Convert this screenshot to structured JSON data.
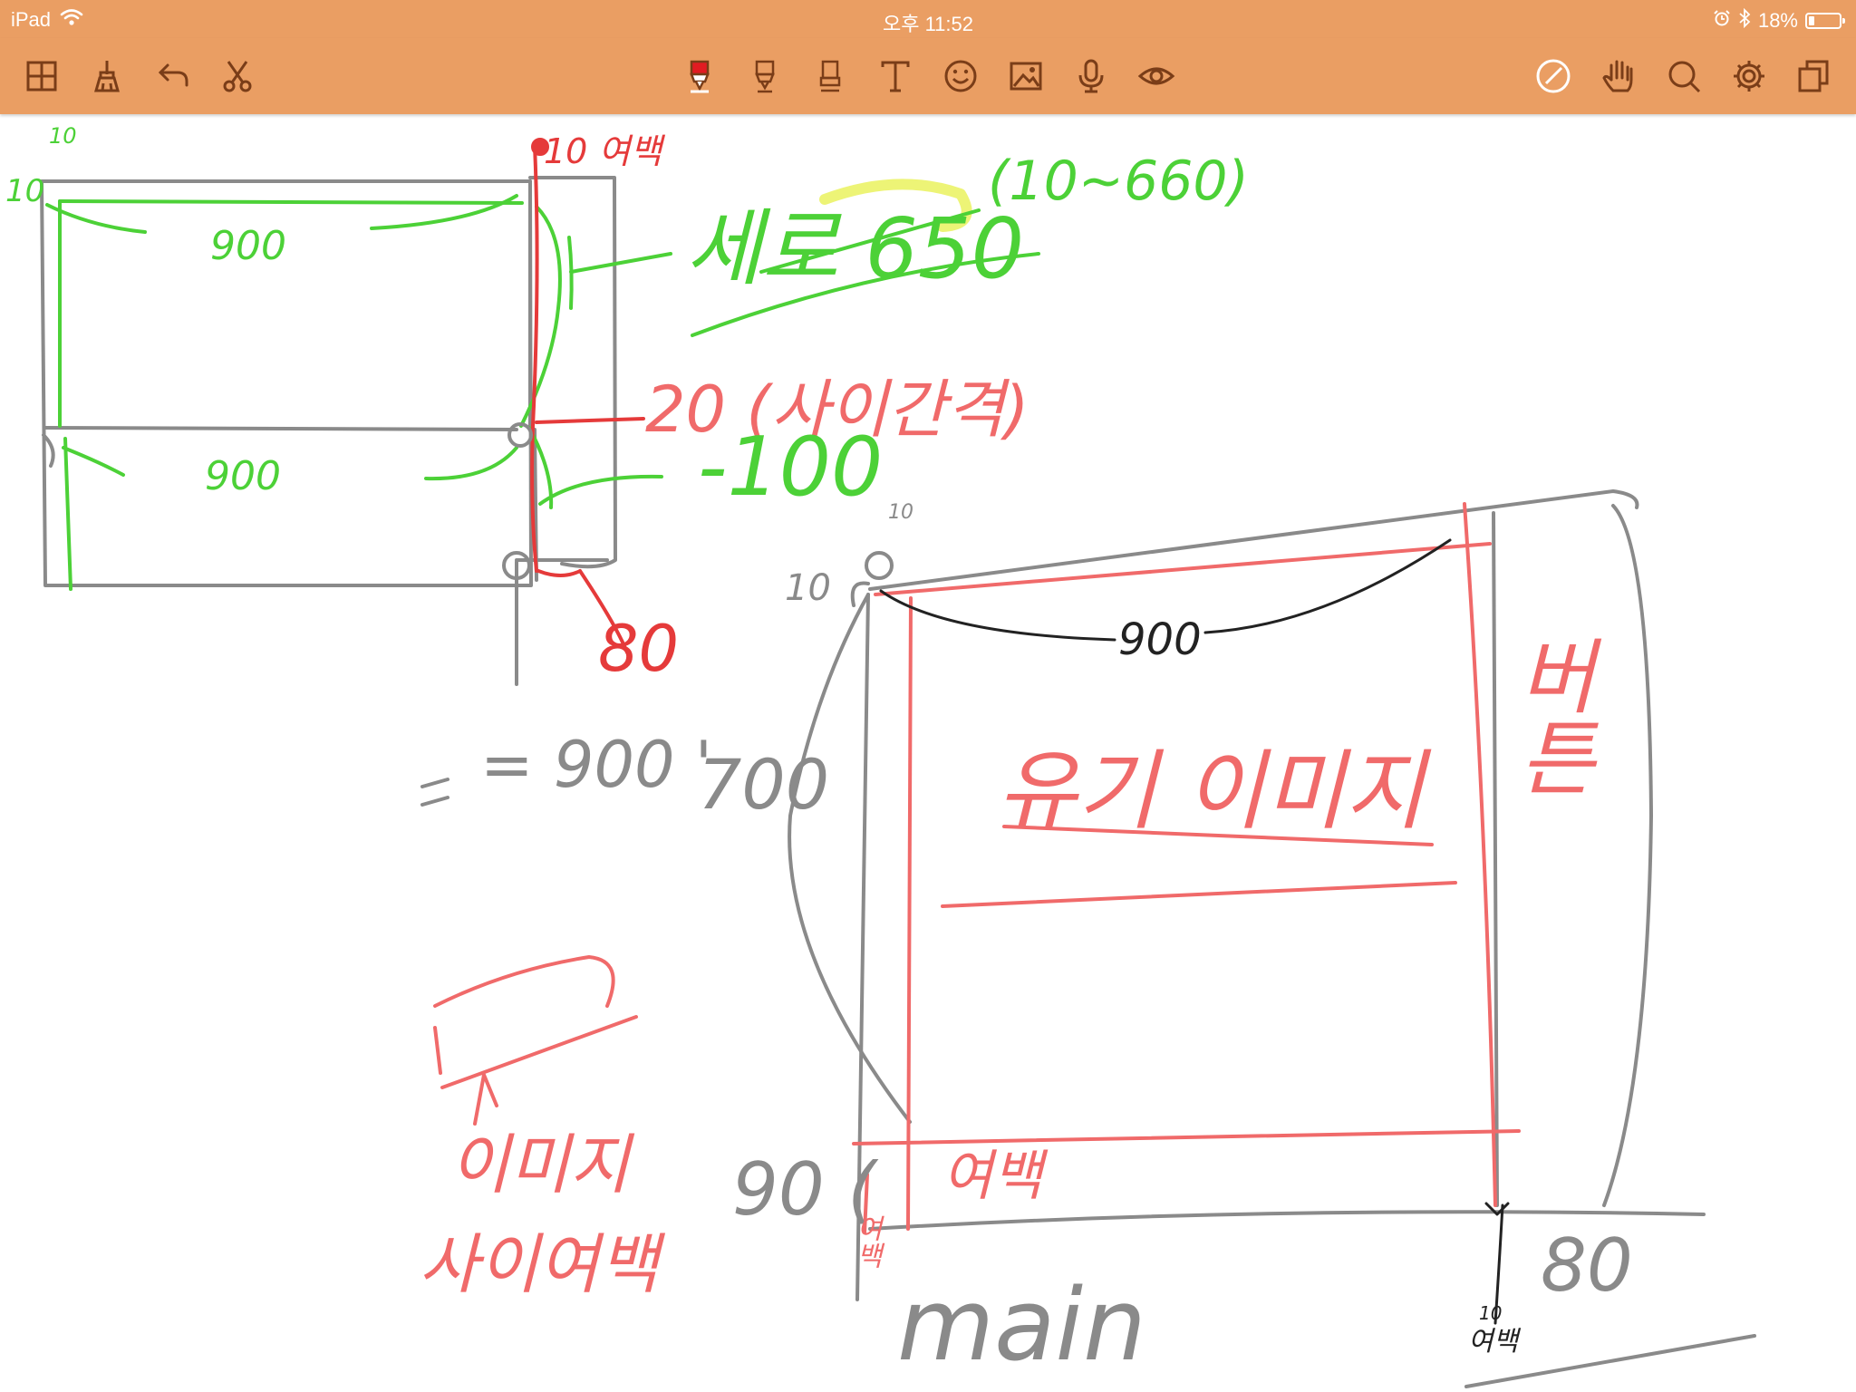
{
  "status_bar": {
    "device": "iPad",
    "time": "오후 11:52",
    "battery_percent": "18%",
    "battery_level": 0.18,
    "icons": [
      "wifi-icon",
      "alarm-icon",
      "bluetooth-icon",
      "battery-icon"
    ]
  },
  "toolbar": {
    "left_tools": [
      "grid-view-icon",
      "cleaner-icon",
      "undo-icon",
      "scissors-icon"
    ],
    "center_tools": [
      "pen-icon",
      "marker-icon",
      "highlighter-icon",
      "text-icon",
      "emoji-icon",
      "image-icon",
      "microphone-icon",
      "eye-icon"
    ],
    "right_tools": [
      "compass-icon",
      "hand-icon",
      "search-icon",
      "settings-icon",
      "pages-icon"
    ],
    "selected_tool": "pen-icon",
    "accent_color": "#e11b22",
    "bar_color": "#ea9e63"
  },
  "colors": {
    "ink_gray": "#8a8a8a",
    "ink_green": "#4cd137",
    "ink_red": "#f06a6a",
    "ink_dark_red": "#e53a3a",
    "ink_yellow": "#e6f03c",
    "ink_black": "#222222"
  },
  "handwriting": {
    "top_small_10": "10",
    "left_10": "10",
    "width_upper": "900",
    "width_lower": "900",
    "margin_top": "10 여백",
    "height_650": "세로 650",
    "range": "(10~660)",
    "gap_20": "20 (사이간격)",
    "dim_100": "-100",
    "dim_80_upper": "80",
    "dim_equals_900": "= 900 '",
    "top_10_right": "10",
    "left_10_right": "10",
    "width_900_right": "900",
    "height_700": "700",
    "image_label": "유기 이미지",
    "side_label": "버튼",
    "bottom_90": "90 (",
    "margin_label_small": "여백",
    "margin_label": "여백",
    "image_margin_1": "이미지",
    "image_margin_2": "사이여백",
    "main_label": "main",
    "dim_80_right": "80",
    "tiny_10": "10",
    "tiny_margin": "여백"
  }
}
